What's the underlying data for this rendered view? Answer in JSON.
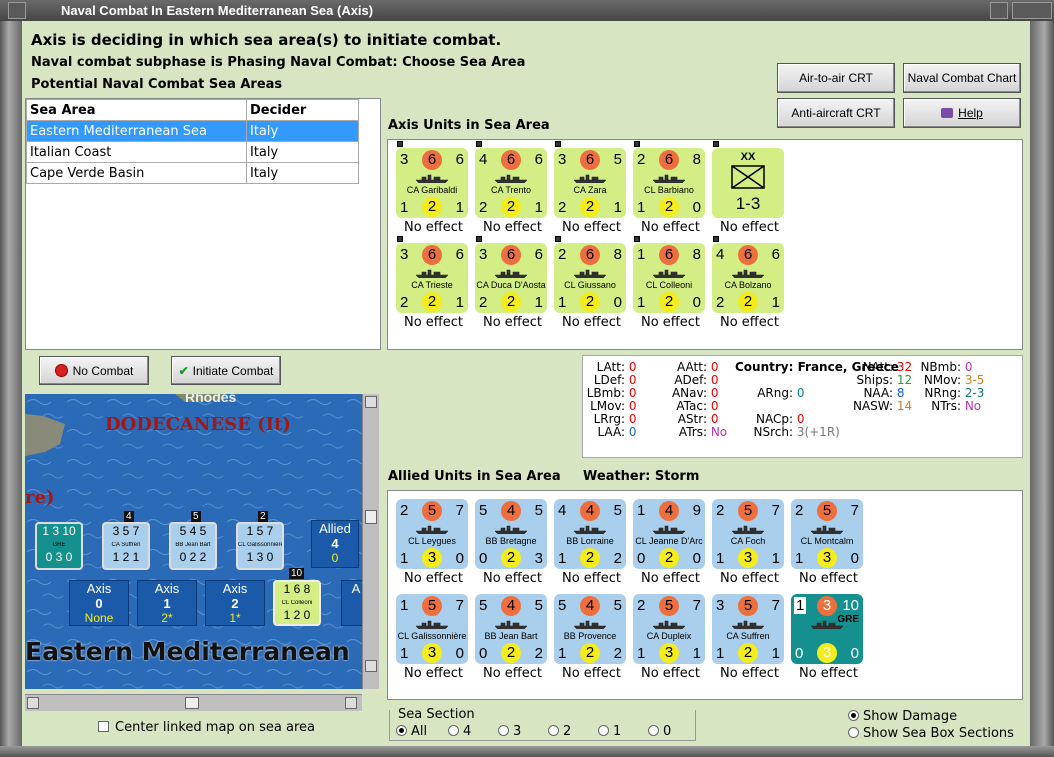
{
  "window": {
    "title": "Naval Combat In Eastern Mediterranean Sea (Axis)"
  },
  "header": {
    "line1": "Axis is deciding in which sea area(s) to initiate combat.",
    "line2": "Naval combat subphase is Phasing Naval Combat: Choose Sea Area",
    "line3": "Potential Naval Combat Sea Areas"
  },
  "buttons": {
    "air_to_air": "Air-to-air CRT",
    "naval_chart": "Naval Combat Chart",
    "anti_aircraft": "Anti-aircraft CRT",
    "help": "Help",
    "no_combat": "No Combat",
    "initiate": "Initiate Combat"
  },
  "sea_table": {
    "headers": [
      "Sea Area",
      "Decider"
    ],
    "rows": [
      [
        "Eastern Mediterranean Sea",
        "Italy"
      ],
      [
        "Italian Coast",
        "Italy"
      ],
      [
        "Cape Verde Basin",
        "Italy"
      ]
    ]
  },
  "axis_title": "Axis Units in Sea Area",
  "axis_units": [
    {
      "tl": "3",
      "tc": "6",
      "tr": "6",
      "name": "CA Garibaldi",
      "bl": "1",
      "bc": "2",
      "br": "1",
      "effect": "No effect"
    },
    {
      "tl": "4",
      "tc": "6",
      "tr": "6",
      "name": "CA Trento",
      "bl": "2",
      "bc": "2",
      "br": "1",
      "effect": "No effect"
    },
    {
      "tl": "3",
      "tc": "6",
      "tr": "5",
      "name": "CA Zara",
      "bl": "2",
      "bc": "2",
      "br": "1",
      "effect": "No effect"
    },
    {
      "tl": "2",
      "tc": "6",
      "tr": "8",
      "name": "CL Barbiano",
      "bl": "1",
      "bc": "2",
      "br": "0",
      "effect": "No effect"
    },
    {
      "type": "XX",
      "value": "1-3",
      "effect": "No effect"
    },
    {
      "tl": "3",
      "tc": "6",
      "tr": "6",
      "name": "CA Trieste",
      "bl": "2",
      "bc": "2",
      "br": "1",
      "effect": "No effect"
    },
    {
      "tl": "3",
      "tc": "6",
      "tr": "6",
      "name": "CA Duca D'Aosta",
      "bl": "2",
      "bc": "2",
      "br": "1",
      "effect": "No effect"
    },
    {
      "tl": "2",
      "tc": "6",
      "tr": "8",
      "name": "CL Giussano",
      "bl": "1",
      "bc": "2",
      "br": "0",
      "effect": "No effect"
    },
    {
      "tl": "1",
      "tc": "6",
      "tr": "8",
      "name": "CL Colleoni",
      "bl": "1",
      "bc": "2",
      "br": "0",
      "effect": "No effect"
    },
    {
      "tl": "4",
      "tc": "6",
      "tr": "6",
      "name": "CA Bolzano",
      "bl": "2",
      "bc": "2",
      "br": "1",
      "effect": "No effect"
    }
  ],
  "stats": {
    "col1": [
      [
        "LAtt:",
        "0"
      ],
      [
        "LDef:",
        "0"
      ],
      [
        "LBmb:",
        "0"
      ],
      [
        "LMov:",
        "0"
      ],
      [
        "LRrg:",
        "0"
      ],
      [
        "LAA:",
        "0"
      ]
    ],
    "col2": [
      [
        "AAtt:",
        "0"
      ],
      [
        "ADef:",
        "0"
      ],
      [
        "ANav:",
        "0"
      ],
      [
        "ATac:",
        "0"
      ],
      [
        "AStr:",
        "0"
      ],
      [
        "ATrs:",
        "No"
      ]
    ],
    "country_label": "Country:",
    "country": "France, Greece",
    "arng": [
      "ARng:",
      "0"
    ],
    "nacp": [
      "NACp:",
      "0"
    ],
    "nsrch": [
      "NSrch:",
      "3(+1R)"
    ],
    "col4": [
      [
        "NAtt:",
        "32"
      ],
      [
        "Ships:",
        "12"
      ],
      [
        "NAA:",
        "8"
      ],
      [
        "NASW:",
        "14"
      ]
    ],
    "col5": [
      [
        "NBmb:",
        "0"
      ],
      [
        "NMov:",
        "3-5"
      ],
      [
        "NRng:",
        "2-3"
      ],
      [
        "NTrs:",
        "No"
      ]
    ]
  },
  "allied_title": "Allied Units in Sea Area",
  "weather_label": "Weather:",
  "weather": "Storm",
  "allied_units": [
    {
      "tl": "2",
      "tc": "5",
      "tr": "7",
      "name": "CL Leygues",
      "bl": "1",
      "bc": "3",
      "br": "0",
      "effect": "No effect"
    },
    {
      "tl": "5",
      "tc": "4",
      "tr": "5",
      "name": "BB Bretagne",
      "bl": "0",
      "bc": "2",
      "br": "3",
      "effect": "No effect"
    },
    {
      "tl": "4",
      "tc": "4",
      "tr": "5",
      "name": "BB Lorraine",
      "bl": "1",
      "bc": "2",
      "br": "2",
      "effect": "No effect"
    },
    {
      "tl": "1",
      "tc": "4",
      "tr": "9",
      "name": "CL Jeanne D'Arc",
      "bl": "0",
      "bc": "2",
      "br": "0",
      "effect": "No effect"
    },
    {
      "tl": "2",
      "tc": "5",
      "tr": "7",
      "name": "CA Foch",
      "bl": "1",
      "bc": "3",
      "br": "1",
      "effect": "No effect"
    },
    {
      "tl": "2",
      "tc": "5",
      "tr": "7",
      "name": "CL Montcalm",
      "bl": "1",
      "bc": "3",
      "br": "0",
      "effect": "No effect"
    },
    {
      "tl": "1",
      "tc": "5",
      "tr": "7",
      "name": "CL Galissonnière",
      "bl": "1",
      "bc": "3",
      "br": "0",
      "effect": "No effect"
    },
    {
      "tl": "5",
      "tc": "4",
      "tr": "5",
      "name": "BB Jean Bart",
      "bl": "0",
      "bc": "2",
      "br": "2",
      "effect": "No effect"
    },
    {
      "tl": "5",
      "tc": "4",
      "tr": "5",
      "name": "BB Provence",
      "bl": "1",
      "bc": "2",
      "br": "2",
      "effect": "No effect"
    },
    {
      "tl": "2",
      "tc": "5",
      "tr": "7",
      "name": "CA Dupleix",
      "bl": "1",
      "bc": "3",
      "br": "1",
      "effect": "No effect"
    },
    {
      "tl": "3",
      "tc": "5",
      "tr": "7",
      "name": "CA Suffren",
      "bl": "1",
      "bc": "2",
      "br": "1",
      "effect": "No effect"
    },
    {
      "tl": "1",
      "tc": "3",
      "tr": "10",
      "name": "GRE",
      "bl": "0",
      "bc": "3",
      "br": "0",
      "effect": "No effect",
      "gre": true
    }
  ],
  "map": {
    "labels": {
      "rhodes": "Rhodes",
      "dodecanese": "DODECANESE (It)",
      "partial": "re)",
      "sea": "Eastern Mediterranean"
    },
    "counters": [
      {
        "tl": "1",
        "tc": "3",
        "tr": "10",
        "name": "GRE",
        "bl": "0",
        "bc": "3",
        "br": "0",
        "cls": "gre",
        "stack": ""
      },
      {
        "tl": "3",
        "tc": "5",
        "tr": "7",
        "name": "CA Suffren",
        "bl": "1",
        "bc": "2",
        "br": "1",
        "cls": "ally",
        "stack": "4"
      },
      {
        "tl": "5",
        "tc": "4",
        "tr": "5",
        "name": "BB Jean Bart",
        "bl": "0",
        "bc": "2",
        "br": "2",
        "cls": "ally",
        "stack": "5"
      },
      {
        "tl": "1",
        "tc": "5",
        "tr": "7",
        "name": "CL Galissonnière",
        "bl": "1",
        "bc": "3",
        "br": "0",
        "cls": "ally",
        "stack": "2"
      }
    ],
    "allied_box": {
      "label": "Allied",
      "value": "4",
      "sub": "0"
    },
    "axis_boxes": [
      {
        "label": "Axis",
        "value": "0",
        "sub": "None"
      },
      {
        "label": "Axis",
        "value": "1",
        "sub": "2*"
      },
      {
        "label": "Axis",
        "value": "2",
        "sub": "1*"
      }
    ],
    "axis_counter": {
      "tl": "1",
      "tc": "6",
      "tr": "8",
      "name": "CL Colleoni",
      "bl": "1",
      "bc": "2",
      "br": "0",
      "stack": "10"
    },
    "axis_partial": "A"
  },
  "center_map": "Center linked map on sea area",
  "sea_section": {
    "title": "Sea Section",
    "options": [
      "All",
      "4",
      "3",
      "2",
      "1",
      "0"
    ],
    "selected": "All"
  },
  "show_damage": "Show Damage",
  "show_sections": "Show Sea Box Sections",
  "colors": {
    "axis": "#d4ee86",
    "allied": "#a9cfec",
    "greek": "#14918f",
    "selection": "#3399ff",
    "client": "#d7e5c2"
  }
}
